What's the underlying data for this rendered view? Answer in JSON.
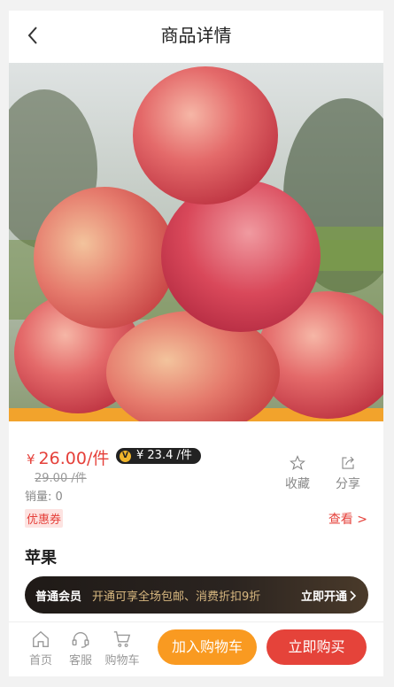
{
  "header": {
    "title": "商品详情"
  },
  "price": {
    "symbol": "¥",
    "amount": "26.00/件",
    "vip_price": "¥ 23.4 /件",
    "original": "29.00 /件"
  },
  "sales": "销量:  0",
  "actions": {
    "favorite": "收藏",
    "share": "分享"
  },
  "coupon": {
    "tag": "优惠券",
    "view": "查看 >"
  },
  "product": {
    "name": "苹果"
  },
  "member": {
    "title": "普通会员",
    "desc": "开通可享全场包邮、消费折扣9折",
    "cta": "立即开通"
  },
  "bottom_nav": {
    "home": "首页",
    "service": "客服",
    "cart": "购物车"
  },
  "buttons": {
    "add_to_cart": "加入购物车",
    "buy_now": "立即购买"
  },
  "colors": {
    "accent_red": "#e5403a",
    "accent_orange": "#f99a21",
    "member_gold": "#d8b880"
  },
  "icons": [
    "back-icon",
    "star-icon",
    "share-icon",
    "home-icon",
    "headset-icon",
    "cart-icon",
    "vip-icon",
    "chevron-right-icon"
  ]
}
